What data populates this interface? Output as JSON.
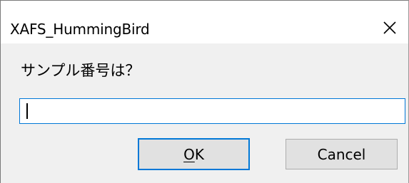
{
  "window": {
    "title": "XAFS_HummingBird",
    "close_icon": "close-icon"
  },
  "dialog": {
    "prompt": "サンプル番号は？",
    "input": {
      "value": "",
      "placeholder": ""
    },
    "ok": {
      "mnemonic": "O",
      "rest": "K"
    },
    "cancel_label": "Cancel"
  },
  "colors": {
    "focus_accent": "#0078d7",
    "button_face": "#e1e1e1",
    "client_background": "#f0f0f0"
  }
}
